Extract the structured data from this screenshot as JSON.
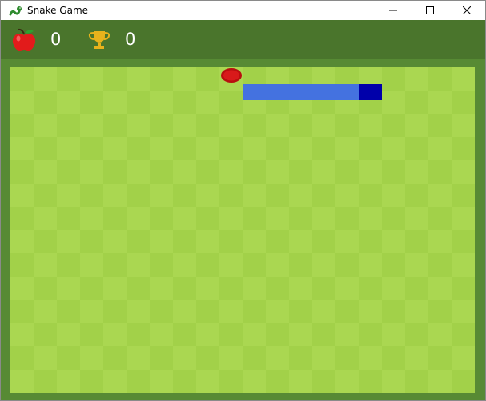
{
  "window": {
    "title": "Snake Game"
  },
  "hud": {
    "apples": "0",
    "best": "0"
  },
  "icons": {
    "app": "snake-icon",
    "apple": "apple-icon",
    "trophy": "trophy-icon",
    "food": "food-icon"
  },
  "colors": {
    "header": "#4a752c",
    "board_border": "#578a34",
    "grass_light": "#aad751",
    "grass_dark": "#a2d149",
    "snake_body": "#4472e0",
    "snake_head": "#0000aa",
    "food": "#cc1111"
  }
}
